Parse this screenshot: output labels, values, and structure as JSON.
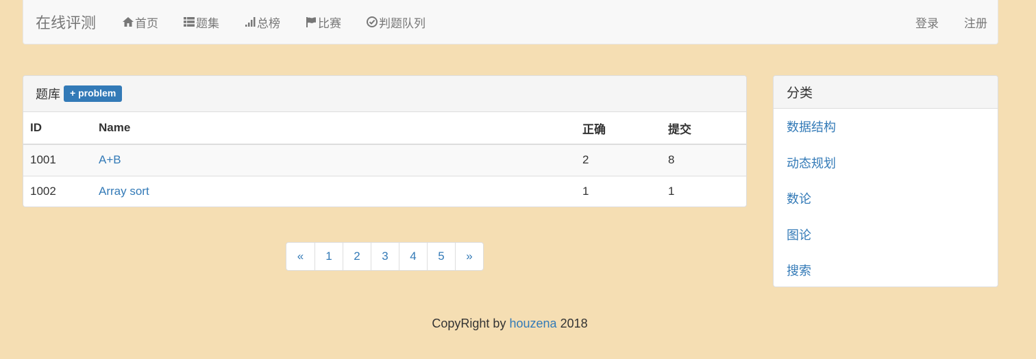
{
  "navbar": {
    "brand": "在线评测",
    "items": [
      {
        "label": "首页",
        "icon": "home-icon"
      },
      {
        "label": "题集",
        "icon": "list-icon"
      },
      {
        "label": "总榜",
        "icon": "signal-bars-icon"
      },
      {
        "label": "比赛",
        "icon": "flag-icon"
      },
      {
        "label": "判题队列",
        "icon": "check-circle-icon"
      }
    ],
    "login": "登录",
    "register": "注册"
  },
  "problems": {
    "title": "题库",
    "add_label": "+ problem",
    "columns": [
      "ID",
      "Name",
      "正确",
      "提交"
    ],
    "rows": [
      {
        "id": "1001",
        "name": "A+B",
        "accepted": "2",
        "submitted": "8"
      },
      {
        "id": "1002",
        "name": "Array sort",
        "accepted": "1",
        "submitted": "1"
      }
    ]
  },
  "pagination": {
    "prev": "«",
    "pages": [
      "1",
      "2",
      "3",
      "4",
      "5"
    ],
    "next": "»"
  },
  "categories": {
    "title": "分类",
    "items": [
      "数据结构",
      "动态规划",
      "数论",
      "图论",
      "搜索"
    ]
  },
  "footer": {
    "prefix": "CopyRight by",
    "author": "houzena",
    "year": "2018"
  },
  "colors": {
    "background": "#f5deb3",
    "link": "#337ab7"
  }
}
